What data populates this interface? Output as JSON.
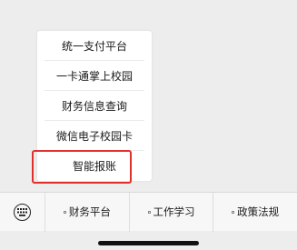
{
  "popup": {
    "items": [
      {
        "label": "统一支付平台"
      },
      {
        "label": "一卡通掌上校园"
      },
      {
        "label": "财务信息查询"
      },
      {
        "label": "微信电子校园卡"
      },
      {
        "label": "智能报账"
      }
    ],
    "highlighted_index": 4,
    "highlight_color": "#e0312d"
  },
  "menubar": {
    "keyboard_icon": "keyboard-icon",
    "tabs": [
      {
        "label": "财务平台"
      },
      {
        "label": "工作学习"
      },
      {
        "label": "政策法规"
      }
    ]
  }
}
